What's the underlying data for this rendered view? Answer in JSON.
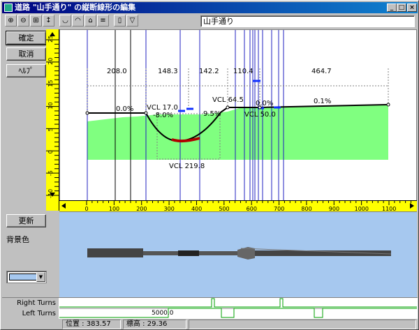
{
  "window": {
    "title": "道路 \"山手通り\" の縦断線形の編集",
    "min": "_",
    "max": "□",
    "close": "×"
  },
  "toolbar": {
    "road_name": "山手通り"
  },
  "left_panel": {
    "ok_label": "確定",
    "cancel_label": "取消",
    "help_label": "ﾍﾙﾌﾟ",
    "update_label": "更新",
    "bgcolor_label": "背景色",
    "bgcolor": "#a6c8ef"
  },
  "profile": {
    "segments": [
      "208.0",
      "148.3",
      "142.2",
      "110.4",
      "464.7"
    ],
    "grades": [
      "0.0%",
      "-8.0%",
      "9.5%",
      "0.0%",
      "0.1%"
    ],
    "vcl": [
      "VCL  17.0",
      "VCL  64.5",
      "VCL  50.0",
      "VCL  219.8"
    ],
    "y_ticks": [
      "25",
      "20",
      "15",
      "10",
      "5",
      "0",
      "-5",
      "-10"
    ],
    "x_ticks": [
      "0",
      "100",
      "200",
      "300",
      "400",
      "500",
      "600",
      "700",
      "800",
      "900",
      "1000",
      "1100"
    ]
  },
  "turns": {
    "right_label": "Right Turns",
    "left_label": "Left Turns",
    "left_value": "5000.0"
  },
  "status": {
    "position": "位置 : 383.57",
    "elevation": "標高 : 29.36"
  }
}
